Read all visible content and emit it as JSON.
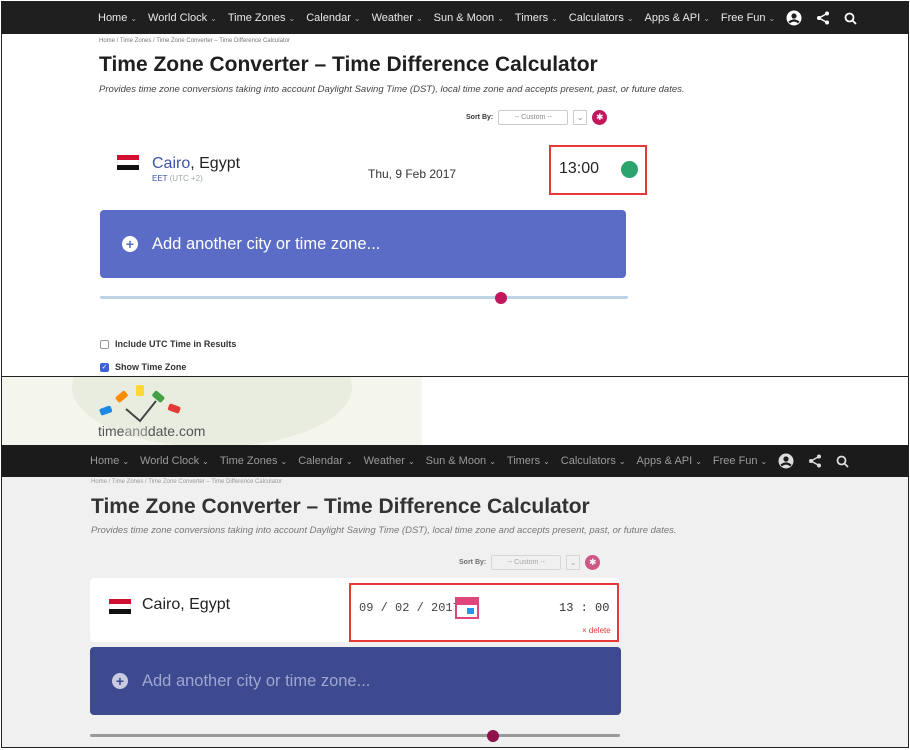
{
  "nav": {
    "items": [
      "Home",
      "World Clock",
      "Time Zones",
      "Calendar",
      "Weather",
      "Sun & Moon",
      "Timers",
      "Calculators",
      "Apps & API",
      "Free Fun"
    ]
  },
  "breadcrumb": "Home /  Time Zones /  Time Zone Converter – Time Difference Calculator",
  "page": {
    "title": "Time Zone Converter – Time Difference Calculator",
    "subtitle": "Provides time zone conversions taking into account Daylight Saving Time (DST), local time zone and accepts present, past, or future dates."
  },
  "sort": {
    "label": "Sort By:",
    "selected": "-- Custom --"
  },
  "city": {
    "name": "Cairo",
    "country": ", Egypt",
    "full": "Cairo, Egypt",
    "zone": "EET",
    "offset": " (UTC +2)",
    "date_text": "Thu, 9 Feb 2017",
    "time": "13:00",
    "date_day": "09",
    "date_month": "02",
    "date_year": "2017",
    "time_hour": "13",
    "time_min": "00",
    "delete_label": "× delete"
  },
  "add_city_label": "Add another city or time zone...",
  "options": {
    "include_utc": {
      "label": "Include UTC Time in Results",
      "checked": false
    },
    "show_zone": {
      "label": "Show Time Zone",
      "checked": true
    }
  },
  "logo": {
    "time": "time",
    "and": "and",
    "date": "date.com"
  },
  "colors": {
    "accent": "#c2185b",
    "add_button": "#5a6cc6",
    "highlight": "#e53935",
    "status_dot": "#2ba56d"
  }
}
